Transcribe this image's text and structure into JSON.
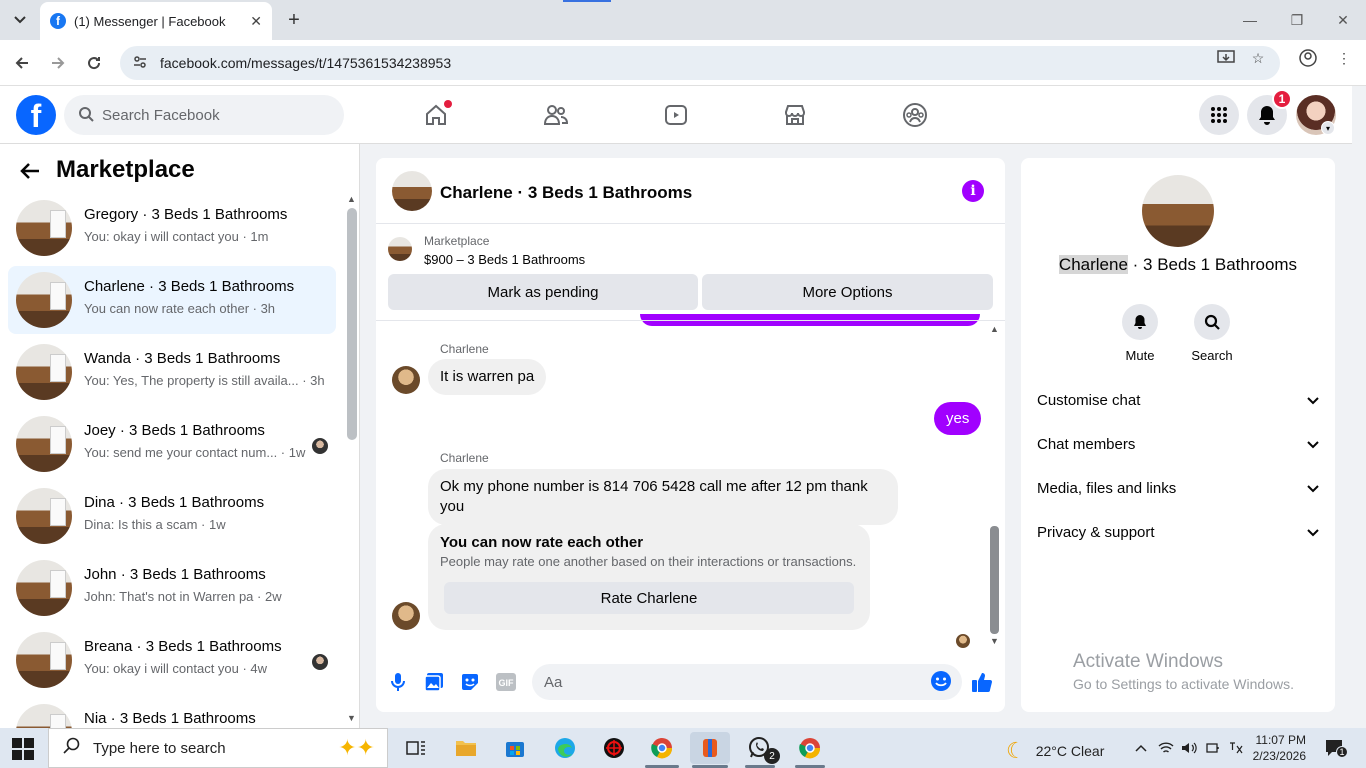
{
  "browser": {
    "tab_title": "(1) Messenger | Facebook",
    "tab_favicon": "f",
    "url": "facebook.com/messages/t/1475361534238953"
  },
  "header": {
    "logo": "f",
    "search_placeholder": "Search Facebook",
    "notification_count": "1",
    "nav_icons": [
      "home-icon",
      "friends-icon",
      "video-icon",
      "marketplace-icon",
      "groups-icon"
    ]
  },
  "sidebar": {
    "title": "Marketplace",
    "conversations": [
      {
        "name": "Gregory · 3 Beds 1 Bathrooms",
        "preview": "You: okay i will contact you · 1m"
      },
      {
        "name": "Charlene · 3 Beds 1 Bathrooms",
        "preview": "You can now rate each other · 3h"
      },
      {
        "name": "Wanda · 3 Beds 1 Bathrooms",
        "preview": "You: Yes, The property is still availa...  · 3h"
      },
      {
        "name": "Joey · 3 Beds 1 Bathrooms",
        "preview": "You: send me your contact num...  · 1w"
      },
      {
        "name": "Dina · 3 Beds 1 Bathrooms",
        "preview": "Dina: Is this a scam · 1w"
      },
      {
        "name": "John · 3 Beds 1 Bathrooms",
        "preview": "John: That's not in Warren pa · 2w"
      },
      {
        "name": "Breana · 3 Beds 1 Bathrooms",
        "preview": "You: okay i will contact you · 4w"
      },
      {
        "name": "Nia · 3 Beds 1 Bathrooms",
        "preview": ""
      }
    ]
  },
  "chat": {
    "title": "Charlene · 3 Beds 1 Bathrooms",
    "listing_label": "Marketplace",
    "listing_price": "$900 – 3 Beds 1 Bathrooms",
    "mark_pending": "Mark as pending",
    "more_options": "More Options",
    "messages": [
      {
        "sender": "Charlene",
        "text": "It is warren pa"
      },
      {
        "text": "yes"
      },
      {
        "sender": "Charlene",
        "text": "Ok my phone number is 814 706 5428 call me after 12 pm thank you"
      }
    ],
    "rate_title": "You can now rate each other",
    "rate_sub": "People may rate one another based on their interactions or transactions.",
    "rate_button": "Rate Charlene",
    "composer_placeholder": "Aa",
    "gif_label": "GIF"
  },
  "details": {
    "name_first": "Charlene",
    "name_rest": " · 3 Beds 1 Bathrooms",
    "mute": "Mute",
    "search": "Search",
    "sections": [
      "Customise chat",
      "Chat members",
      "Media, files and links",
      "Privacy & support"
    ],
    "watermark_title": "Activate Windows",
    "watermark_sub": "Go to Settings to activate Windows."
  },
  "taskbar": {
    "search_placeholder": "Type here to search",
    "whatsapp_badge": "2",
    "weather": "22°C  Clear",
    "time": "11:07 PM",
    "date": "2/23/2026",
    "notif_count": "1"
  },
  "colors": {
    "fb_blue": "#0866ff",
    "messenger_purple": "#a100ff",
    "badge_red": "#e41e3f"
  }
}
